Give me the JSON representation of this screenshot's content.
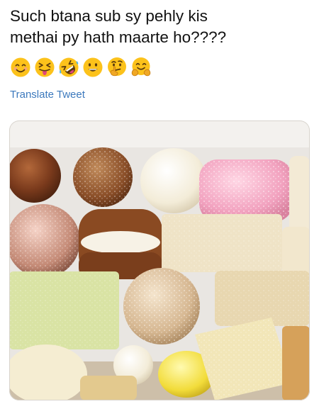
{
  "tweet": {
    "text": "Such btana sub sy pehly kis\nmethai py hath maarte ho????",
    "emojis": [
      {
        "icon": "smiling-face-icon"
      },
      {
        "icon": "squinting-tongue-face-icon"
      },
      {
        "icon": "rolling-laughing-face-icon"
      },
      {
        "icon": "grinning-face-icon"
      },
      {
        "icon": "thinking-face-icon"
      },
      {
        "icon": "hugging-face-icon"
      }
    ],
    "translate_label": "Translate Tweet",
    "link_color": "#3c79bd",
    "photo": {
      "subject": "sweets-box-photo"
    }
  }
}
